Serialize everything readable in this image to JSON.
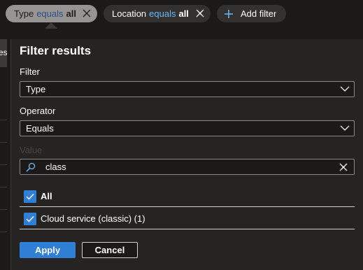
{
  "filter_pills": [
    {
      "field": "Type",
      "operator": "equals",
      "value": "all"
    },
    {
      "field": "Location",
      "operator": "equals",
      "value": "all"
    }
  ],
  "add_filter_label": "Add filter",
  "left_tab_text": "es",
  "panel": {
    "title": "Filter results",
    "filter_label": "Filter",
    "filter_value": "Type",
    "operator_label": "Operator",
    "operator_value": "Equals",
    "value_label": "Value",
    "search_value": "class",
    "options": [
      {
        "label": "All",
        "checked": true
      },
      {
        "label": "Cloud service (classic) (1)",
        "checked": true
      }
    ],
    "apply_label": "Apply",
    "cancel_label": "Cancel"
  },
  "colors": {
    "accent": "#2f7fd6",
    "background": "#1b1a19",
    "panel": "#252423",
    "operator_text": "#6cb8f6"
  },
  "icons": [
    "close-icon",
    "plus-icon",
    "chevron-down-icon",
    "search-icon",
    "checkmark-icon"
  ]
}
